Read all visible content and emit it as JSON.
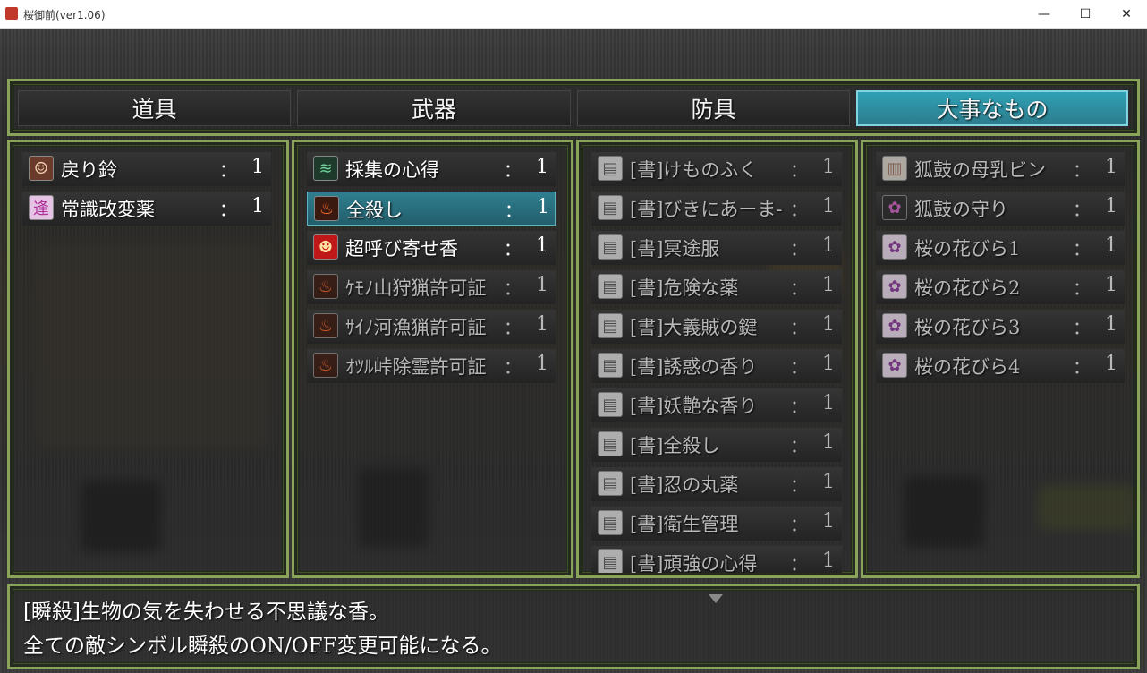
{
  "window": {
    "title": "桜御前(ver1.06)",
    "minimize_glyph": "—",
    "maximize_glyph": "☐",
    "close_glyph": "✕"
  },
  "tabs": [
    {
      "label": "道具",
      "active": false
    },
    {
      "label": "武器",
      "active": false
    },
    {
      "label": "防具",
      "active": false
    },
    {
      "label": "大事なもの",
      "active": true
    }
  ],
  "columns": [
    {
      "items": [
        {
          "name": "戻り鈴",
          "colon": "：",
          "count": "1",
          "icon": "girl-face-icon",
          "glyph": "☺",
          "bg": "#6a3a2a",
          "fg": "#f0d0b0",
          "dim": false,
          "selected": false
        },
        {
          "name": "常識改変薬",
          "colon": "：",
          "count": "1",
          "icon": "magic-rune-icon",
          "glyph": "逢",
          "bg": "#e5c3e5",
          "fg": "#b0309a",
          "dim": false,
          "selected": false
        }
      ]
    },
    {
      "items": [
        {
          "name": "採集の心得",
          "colon": "：",
          "count": "1",
          "icon": "wind-icon",
          "glyph": "≋",
          "bg": "#1e3a2a",
          "fg": "#6ed39a",
          "dim": false,
          "selected": false
        },
        {
          "name": "全殺し",
          "colon": "：",
          "count": "1",
          "icon": "flame-icon",
          "glyph": "♨",
          "bg": "#3a1a10",
          "fg": "#ff6a2a",
          "dim": false,
          "selected": true
        },
        {
          "name": "超呼び寄せ香",
          "colon": "：",
          "count": "1",
          "icon": "demon-face-icon",
          "glyph": "☻",
          "bg": "#c01818",
          "fg": "#ffe0a0",
          "dim": false,
          "selected": false
        },
        {
          "name": "ｹﾓﾉ山狩猟許可証",
          "colon": "：",
          "count": "1",
          "icon": "flame-icon",
          "glyph": "♨",
          "bg": "#3a1a10",
          "fg": "#ff6a2a",
          "dim": true,
          "selected": false
        },
        {
          "name": "ｻｲﾉ河漁猟許可証",
          "colon": "：",
          "count": "1",
          "icon": "flame-icon",
          "glyph": "♨",
          "bg": "#3a1a10",
          "fg": "#ff6a2a",
          "dim": true,
          "selected": false
        },
        {
          "name": "ｵﾂﾙ峠除霊許可証",
          "colon": "：",
          "count": "1",
          "icon": "flame-icon",
          "glyph": "♨",
          "bg": "#3a1a10",
          "fg": "#ff6a2a",
          "dim": true,
          "selected": false
        }
      ]
    },
    {
      "items": [
        {
          "name": "[書]けものふく",
          "colon": "：",
          "count": "1",
          "icon": "book-icon",
          "glyph": "▤",
          "bg": "#d8d8d8",
          "fg": "#555",
          "dim": true,
          "selected": false
        },
        {
          "name": "[書]びきにあーま-",
          "colon": "：",
          "count": "1",
          "icon": "book-icon",
          "glyph": "▤",
          "bg": "#d8d8d8",
          "fg": "#555",
          "dim": true,
          "selected": false
        },
        {
          "name": "[書]冥途服",
          "colon": "：",
          "count": "1",
          "icon": "book-icon",
          "glyph": "▤",
          "bg": "#d8d8d8",
          "fg": "#555",
          "dim": true,
          "selected": false
        },
        {
          "name": "[書]危険な薬",
          "colon": "：",
          "count": "1",
          "icon": "book-icon",
          "glyph": "▤",
          "bg": "#d8d8d8",
          "fg": "#555",
          "dim": true,
          "selected": false
        },
        {
          "name": "[書]大義賊の鍵",
          "colon": "：",
          "count": "1",
          "icon": "book-icon",
          "glyph": "▤",
          "bg": "#d8d8d8",
          "fg": "#555",
          "dim": true,
          "selected": false
        },
        {
          "name": "[書]誘惑の香り",
          "colon": "：",
          "count": "1",
          "icon": "book-icon",
          "glyph": "▤",
          "bg": "#d8d8d8",
          "fg": "#555",
          "dim": true,
          "selected": false
        },
        {
          "name": "[書]妖艶な香り",
          "colon": "：",
          "count": "1",
          "icon": "book-icon",
          "glyph": "▤",
          "bg": "#d8d8d8",
          "fg": "#555",
          "dim": true,
          "selected": false
        },
        {
          "name": "[書]全殺し",
          "colon": "：",
          "count": "1",
          "icon": "book-icon",
          "glyph": "▤",
          "bg": "#d8d8d8",
          "fg": "#555",
          "dim": true,
          "selected": false
        },
        {
          "name": "[書]忍の丸薬",
          "colon": "：",
          "count": "1",
          "icon": "book-icon",
          "glyph": "▤",
          "bg": "#d8d8d8",
          "fg": "#555",
          "dim": true,
          "selected": false
        },
        {
          "name": "[書]衛生管理",
          "colon": "：",
          "count": "1",
          "icon": "book-icon",
          "glyph": "▤",
          "bg": "#d8d8d8",
          "fg": "#555",
          "dim": true,
          "selected": false
        },
        {
          "name": "[書]頑強の心得",
          "colon": "：",
          "count": "1",
          "icon": "book-icon",
          "glyph": "▤",
          "bg": "#d8d8d8",
          "fg": "#555",
          "dim": true,
          "selected": false
        }
      ]
    },
    {
      "items": [
        {
          "name": "狐鼓の母乳ビン",
          "colon": "：",
          "count": "1",
          "icon": "bottle-icon",
          "glyph": "▥",
          "bg": "#d8d0c8",
          "fg": "#a07060",
          "dim": true,
          "selected": false
        },
        {
          "name": "狐鼓の守り",
          "colon": "：",
          "count": "1",
          "icon": "charm-icon",
          "glyph": "✿",
          "bg": "#2a2a2a",
          "fg": "#d060c0",
          "dim": true,
          "selected": false
        },
        {
          "name": "桜の花びら1",
          "colon": "：",
          "count": "1",
          "icon": "sakura-petal-icon",
          "glyph": "✿",
          "bg": "#e8d8e8",
          "fg": "#8a3a9a",
          "dim": true,
          "selected": false
        },
        {
          "name": "桜の花びら2",
          "colon": "：",
          "count": "1",
          "icon": "sakura-petal-icon",
          "glyph": "✿",
          "bg": "#e8d8e8",
          "fg": "#8a3a9a",
          "dim": true,
          "selected": false
        },
        {
          "name": "桜の花びら3",
          "colon": "：",
          "count": "1",
          "icon": "sakura-petal-icon",
          "glyph": "✿",
          "bg": "#e8d8e8",
          "fg": "#8a3a9a",
          "dim": true,
          "selected": false
        },
        {
          "name": "桜の花びら4",
          "colon": "：",
          "count": "1",
          "icon": "sakura-petal-icon",
          "glyph": "✿",
          "bg": "#e8d8e8",
          "fg": "#8a3a9a",
          "dim": true,
          "selected": false
        }
      ]
    }
  ],
  "description": {
    "line1": "[瞬殺]生物の気を失わせる不思議な香。",
    "line2": "全ての敵シンボル瞬殺のON/OFF変更可能になる。"
  },
  "scroll_indicator": "down-arrow-icon"
}
